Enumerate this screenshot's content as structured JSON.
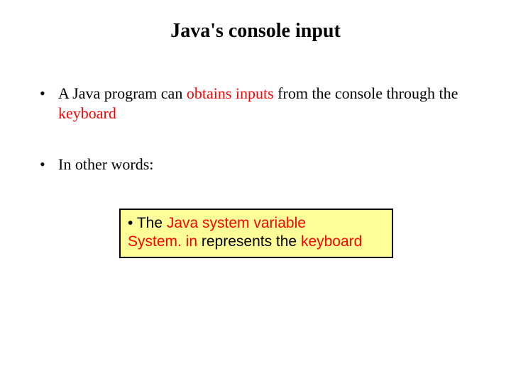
{
  "title": "Java's console input",
  "bullets": {
    "b1": {
      "pre": "A Java program can ",
      "hl1": "obtains inputs",
      "mid": " from the console through the ",
      "hl2": "keyboard"
    },
    "b2": " In other words:"
  },
  "callout": {
    "bullet": "•",
    "line1_a": " The ",
    "line1_b": "Java system variable",
    "line2_a": "System. in",
    "line2_b": " represents the ",
    "line2_c": "keyboard"
  }
}
